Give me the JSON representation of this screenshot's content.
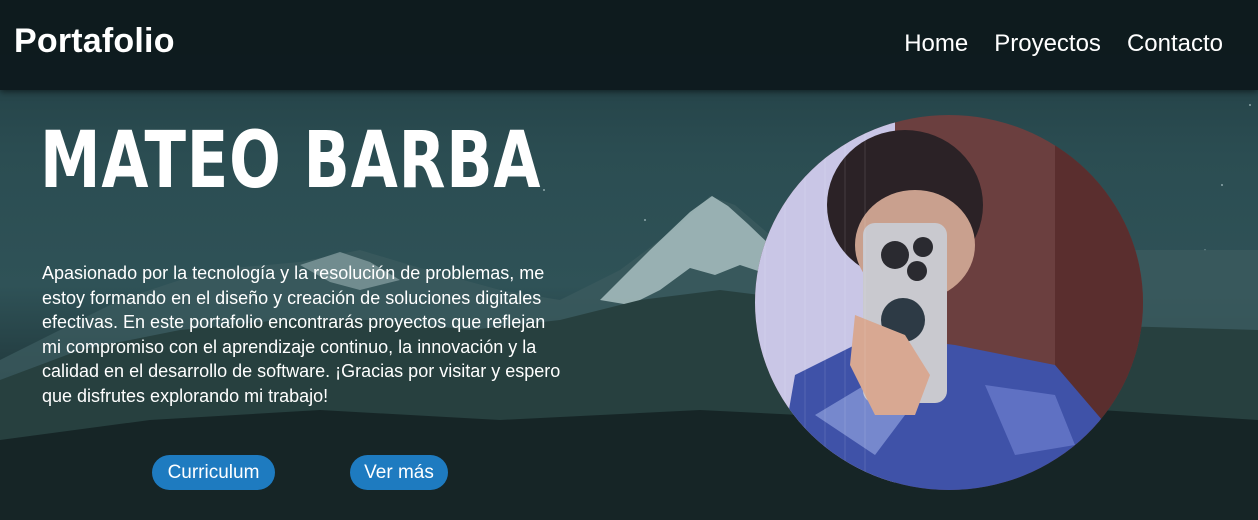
{
  "navbar": {
    "brand": "Portafolio",
    "links": [
      "Home",
      "Proyectos",
      "Contacto"
    ]
  },
  "hero": {
    "name": "MATEO BARBA",
    "description": "Apasionado por la tecnología y la resolución de problemas, me estoy formando en el diseño y creación de soluciones digitales efectivas. En este portafolio encontrarás proyectos que reflejan mi compromiso con el aprendizaje continuo, la innovación y la calidad en el desarrollo de software. ¡Gracias por visitar y espero que disfrutes explorando mi trabajo!",
    "buttons": {
      "curriculum": "Curriculum",
      "more": "Ver más"
    }
  },
  "colors": {
    "button": "#1e7bc0",
    "navbar": "#0e1a1d",
    "text": "#ffffff"
  }
}
